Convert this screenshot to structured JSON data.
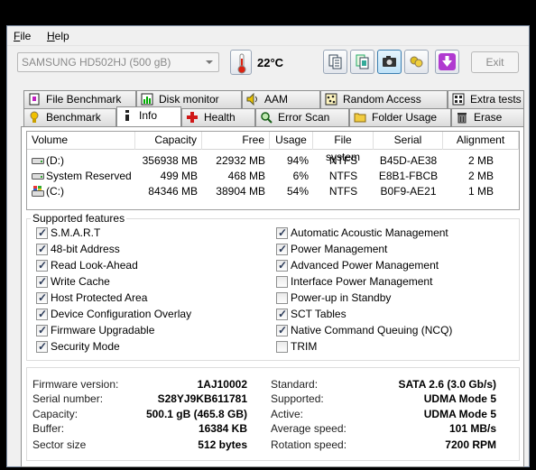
{
  "menu": {
    "file": "File",
    "help": "Help"
  },
  "toolbar": {
    "drive": "SAMSUNG HD502HJ (500 gB)",
    "temperature": "22°C",
    "exit_label": "Exit"
  },
  "tabs_top": [
    {
      "label": "File Benchmark",
      "icon": "file-benchmark-icon"
    },
    {
      "label": "Disk monitor",
      "icon": "disk-monitor-icon"
    },
    {
      "label": "AAM",
      "icon": "speaker-icon"
    },
    {
      "label": "Random Access",
      "icon": "random-access-icon"
    },
    {
      "label": "Extra tests",
      "icon": "extra-tests-icon"
    }
  ],
  "tabs_bottom": [
    {
      "label": "Benchmark",
      "icon": "benchmark-icon"
    },
    {
      "label": "Info",
      "icon": "info-icon"
    },
    {
      "label": "Health",
      "icon": "health-cross-icon"
    },
    {
      "label": "Error Scan",
      "icon": "magnifier-icon"
    },
    {
      "label": "Folder Usage",
      "icon": "folder-icon"
    },
    {
      "label": "Erase",
      "icon": "trash-icon"
    }
  ],
  "volumes": {
    "headers": [
      "Volume",
      "Capacity",
      "Free",
      "Usage",
      "File system",
      "Serial",
      "Alignment"
    ],
    "rows": [
      {
        "volume": "(D:)",
        "capacity": "356938 MB",
        "free": "22932 MB",
        "usage": "94%",
        "fs": "NTFS",
        "serial": "B45D-AE38",
        "alignment": "2 MB",
        "icon": "drive-icon"
      },
      {
        "volume": "System Reserved",
        "capacity": "499 MB",
        "free": "468 MB",
        "usage": "6%",
        "fs": "NTFS",
        "serial": "E8B1-FBCB",
        "alignment": "2 MB",
        "icon": "drive-icon"
      },
      {
        "volume": "(C:)",
        "capacity": "84346 MB",
        "free": "38904 MB",
        "usage": "54%",
        "fs": "NTFS",
        "serial": "B0F9-AE21",
        "alignment": "1 MB",
        "icon": "windows-drive-icon"
      }
    ]
  },
  "features": {
    "title": "Supported features",
    "left": [
      {
        "label": "S.M.A.R.T",
        "checked": true
      },
      {
        "label": "48-bit Address",
        "checked": true
      },
      {
        "label": "Read Look-Ahead",
        "checked": true
      },
      {
        "label": "Write Cache",
        "checked": true
      },
      {
        "label": "Host Protected Area",
        "checked": true
      },
      {
        "label": "Device Configuration Overlay",
        "checked": true
      },
      {
        "label": "Firmware Upgradable",
        "checked": true
      },
      {
        "label": "Security Mode",
        "checked": true
      }
    ],
    "right": [
      {
        "label": "Automatic Acoustic Management",
        "checked": true
      },
      {
        "label": "Power Management",
        "checked": true
      },
      {
        "label": "Advanced Power Management",
        "checked": true
      },
      {
        "label": "Interface Power Management",
        "checked": false
      },
      {
        "label": "Power-up in Standby",
        "checked": false
      },
      {
        "label": "SCT Tables",
        "checked": true
      },
      {
        "label": "Native Command Queuing (NCQ)",
        "checked": true
      },
      {
        "label": "TRIM",
        "checked": false
      }
    ]
  },
  "info": {
    "left": [
      {
        "key": "Firmware version:",
        "value": "1AJ10002"
      },
      {
        "key": "Serial number:",
        "value": "S28YJ9KB611781"
      },
      {
        "key": "Capacity:",
        "value": "500.1 gB (465.8 GB)"
      },
      {
        "key": "Buffer:",
        "value": "16384 KB"
      },
      {
        "key": "Sector size",
        "value": "512 bytes"
      }
    ],
    "right": [
      {
        "key": "Standard:",
        "value": "SATA 2.6 (3.0 Gb/s)"
      },
      {
        "key": "Supported:",
        "value": "UDMA Mode 5"
      },
      {
        "key": "Active:",
        "value": "UDMA Mode 5"
      },
      {
        "key": "Average speed:",
        "value": "101 MB/s"
      },
      {
        "key": "Rotation speed:",
        "value": "7200 RPM"
      }
    ]
  }
}
